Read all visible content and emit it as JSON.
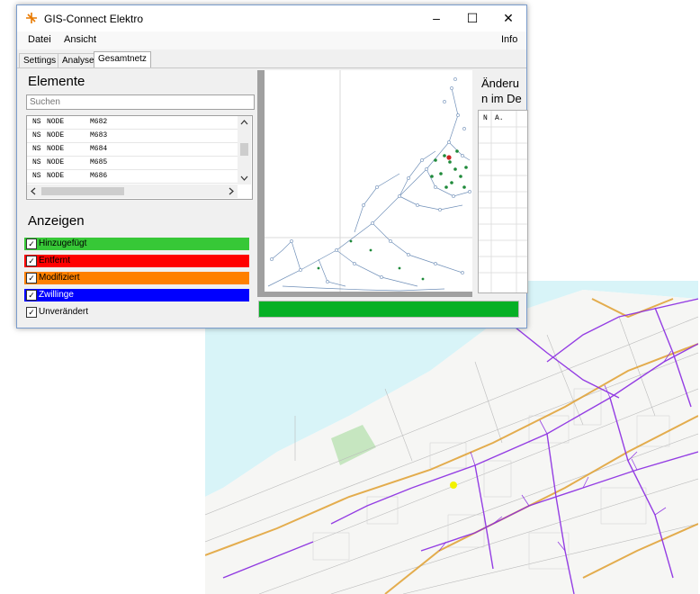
{
  "window": {
    "title": "GIS-Connect Elektro",
    "controls": {
      "minimize": "–",
      "maximize": "☐",
      "close": "✕"
    }
  },
  "menu": {
    "datei": "Datei",
    "ansicht": "Ansicht",
    "info": "Info"
  },
  "tabs": [
    {
      "label": "Settings"
    },
    {
      "label": "Analyse"
    },
    {
      "label": "Gesamtnetz",
      "active": true
    }
  ],
  "elemente": {
    "title": "Elemente",
    "search_placeholder": "Suchen",
    "rows": [
      {
        "net": "NS",
        "type": "NODE",
        "id": "M682"
      },
      {
        "net": "NS",
        "type": "NODE",
        "id": "M683"
      },
      {
        "net": "NS",
        "type": "NODE",
        "id": "M684"
      },
      {
        "net": "NS",
        "type": "NODE",
        "id": "M685"
      },
      {
        "net": "NS",
        "type": "NODE",
        "id": "M686"
      }
    ]
  },
  "anzeigen": {
    "title": "Anzeigen",
    "items": [
      {
        "label": "Hinzugefügt",
        "checked": true,
        "color": "#37c837"
      },
      {
        "label": "Entfernt",
        "checked": true,
        "color": "#ff0000"
      },
      {
        "label": "Modifiziert",
        "checked": true,
        "color": "#ff8000"
      },
      {
        "label": "Zwillinge",
        "checked": true,
        "color": "#0000ff"
      },
      {
        "label": "Unverändert",
        "checked": true,
        "color": ""
      }
    ]
  },
  "aenderungen": {
    "title_line1": "Änderu",
    "title_line2": "n im De",
    "columns": [
      "N",
      "A."
    ]
  },
  "progress": {
    "value": 1.0,
    "color": "#06b025"
  },
  "icons": {
    "app": "lightning-icon",
    "scroll_up": "chevron-up-icon",
    "scroll_down": "chevron-down-icon",
    "scroll_left": "chevron-left-icon",
    "scroll_right": "chevron-right-icon",
    "check": "checkmark-icon"
  }
}
